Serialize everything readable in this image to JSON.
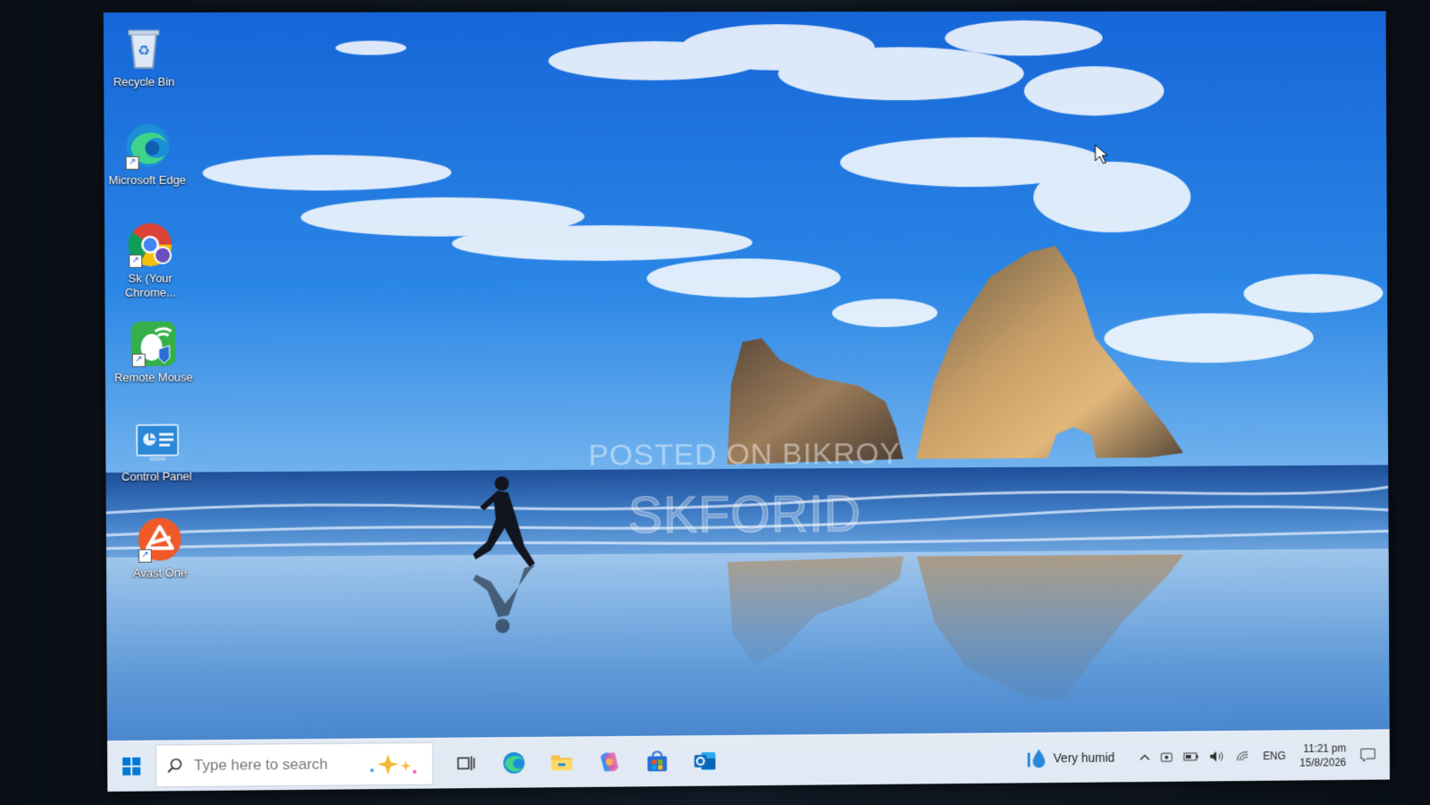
{
  "desktop": {
    "icons": [
      {
        "label": "Recycle Bin"
      },
      {
        "label": "Microsoft Edge"
      },
      {
        "label": "Sk (Your Chrome..."
      },
      {
        "label": "Remote Mouse"
      },
      {
        "label": "Control Panel"
      },
      {
        "label": "Avast One"
      }
    ]
  },
  "watermark": {
    "line1": "POSTED ON BIKROY",
    "line2": "SKFORID"
  },
  "taskbar": {
    "search_placeholder": "Type here to search",
    "apps": [
      "task-view",
      "edge",
      "file-explorer",
      "copilot",
      "microsoft-store",
      "outlook"
    ],
    "weather": "Very humid",
    "language": "ENG",
    "time": "11:21 pm",
    "date": "15/8/2026"
  },
  "colors": {
    "accent": "#0078d4",
    "taskbar_bg": "#e8eef6"
  }
}
